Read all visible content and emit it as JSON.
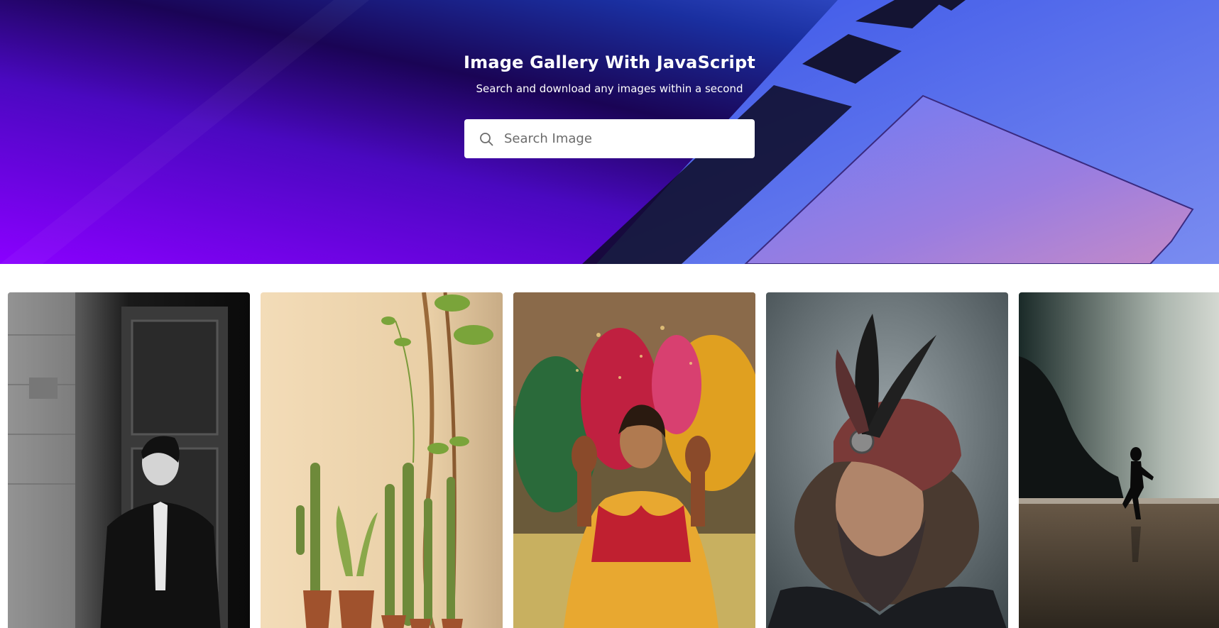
{
  "hero": {
    "title": "Image Gallery With JavaScript",
    "subtitle": "Search and download any images within a second"
  },
  "search": {
    "placeholder": "Search Image",
    "value": "",
    "icon": "search-icon"
  },
  "gallery": {
    "images": [
      {
        "subject": "man-in-suit-bw"
      },
      {
        "subject": "cactus-plants"
      },
      {
        "subject": "bride-celebration"
      },
      {
        "subject": "man-with-turban"
      },
      {
        "subject": "woman-on-beach"
      }
    ]
  },
  "colors": {
    "hero_purple": "#5a0fd0",
    "hero_dark": "#1e0560",
    "hero_blue": "#2a48d6",
    "page_bg": "#ffffff"
  }
}
